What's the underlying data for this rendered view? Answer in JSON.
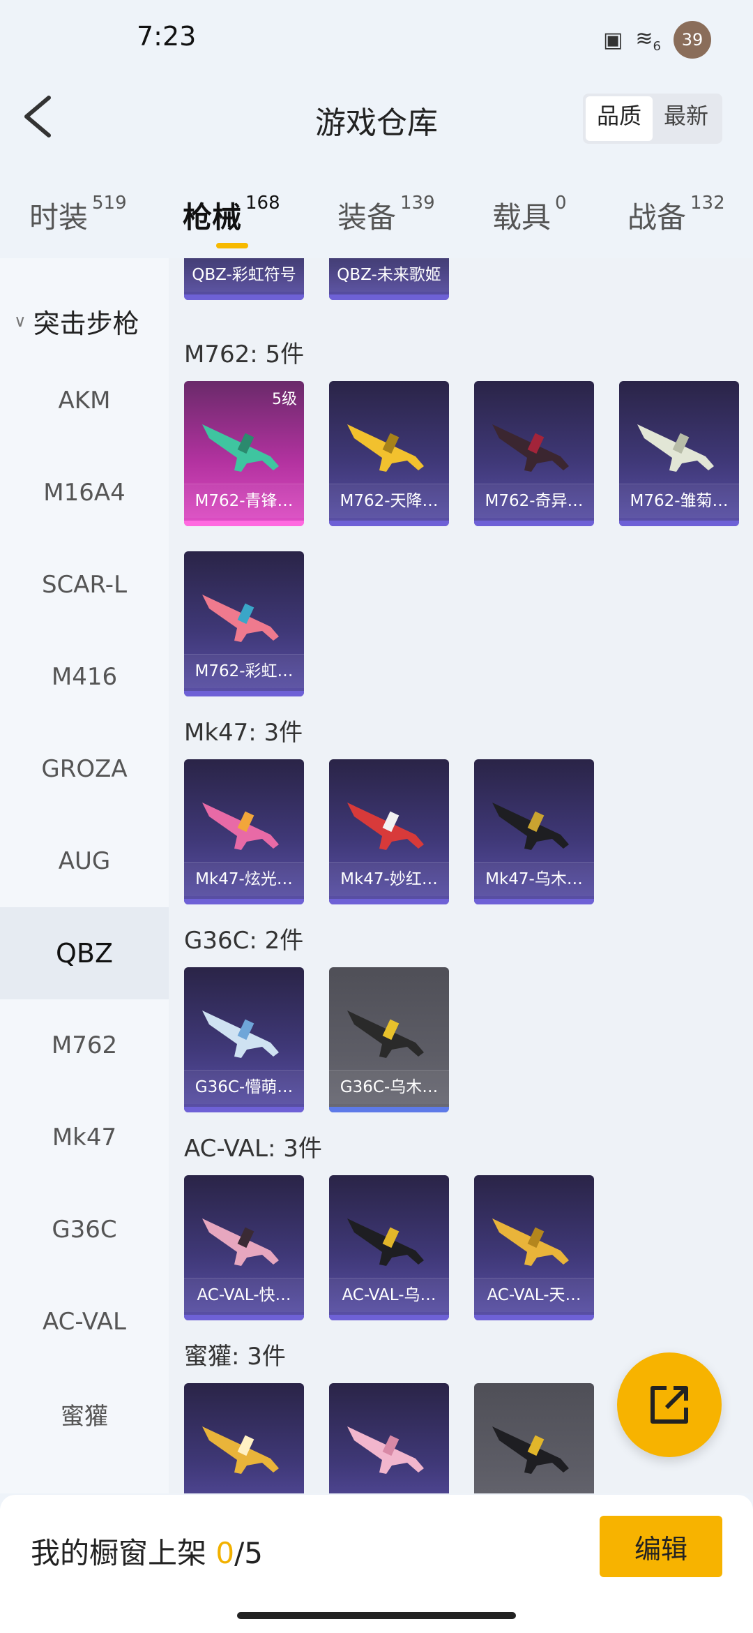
{
  "status": {
    "time": "7:23",
    "network": "6",
    "battery": "39"
  },
  "header": {
    "title": "游戏仓库",
    "sort_options": [
      "品质",
      "最新"
    ],
    "sort_selected": "品质"
  },
  "tabs": [
    {
      "label": "时装",
      "count": "519"
    },
    {
      "label": "枪械",
      "count": "168",
      "active": true
    },
    {
      "label": "装备",
      "count": "139"
    },
    {
      "label": "载具",
      "count": "0"
    },
    {
      "label": "战备",
      "count": "132"
    }
  ],
  "sidebar": {
    "group": "突击步枪",
    "items": [
      "AKM",
      "M16A4",
      "SCAR-L",
      "M416",
      "GROZA",
      "AUG",
      "QBZ",
      "M762",
      "Mk47",
      "G36C",
      "AC-VAL",
      "蜜獾"
    ],
    "active": "QBZ"
  },
  "sections": [
    {
      "title": "",
      "items": [
        {
          "name": "QBZ-彩虹符号"
        },
        {
          "name": "QBZ-未来歌姬"
        }
      ]
    },
    {
      "title": "M762: 5件",
      "items": [
        {
          "name": "M762-青锋…",
          "level": "5级"
        },
        {
          "name": "M762-天降…"
        },
        {
          "name": "M762-奇异…"
        },
        {
          "name": "M762-雏菊…"
        },
        {
          "name": "M762-彩虹…"
        }
      ]
    },
    {
      "title": "Mk47: 3件",
      "items": [
        {
          "name": "Mk47-炫光…"
        },
        {
          "name": "Mk47-妙红…"
        },
        {
          "name": "Mk47-乌木…"
        }
      ]
    },
    {
      "title": "G36C: 2件",
      "items": [
        {
          "name": "G36C-懵萌…"
        },
        {
          "name": "G36C-乌木…"
        }
      ]
    },
    {
      "title": "AC-VAL: 3件",
      "items": [
        {
          "name": "AC-VAL-快…"
        },
        {
          "name": "AC-VAL-乌…"
        },
        {
          "name": "AC-VAL-天…"
        }
      ]
    },
    {
      "title": "蜜獾: 3件",
      "items": []
    }
  ],
  "bottom": {
    "label": "我的橱窗上架",
    "current": "0",
    "total": "/5",
    "edit_label": "编辑"
  },
  "colors": {
    "accent": "#f7b300",
    "card_purple": "#3f3877",
    "card_pink": "#b2329f",
    "card_gray": "#5d5d66"
  }
}
